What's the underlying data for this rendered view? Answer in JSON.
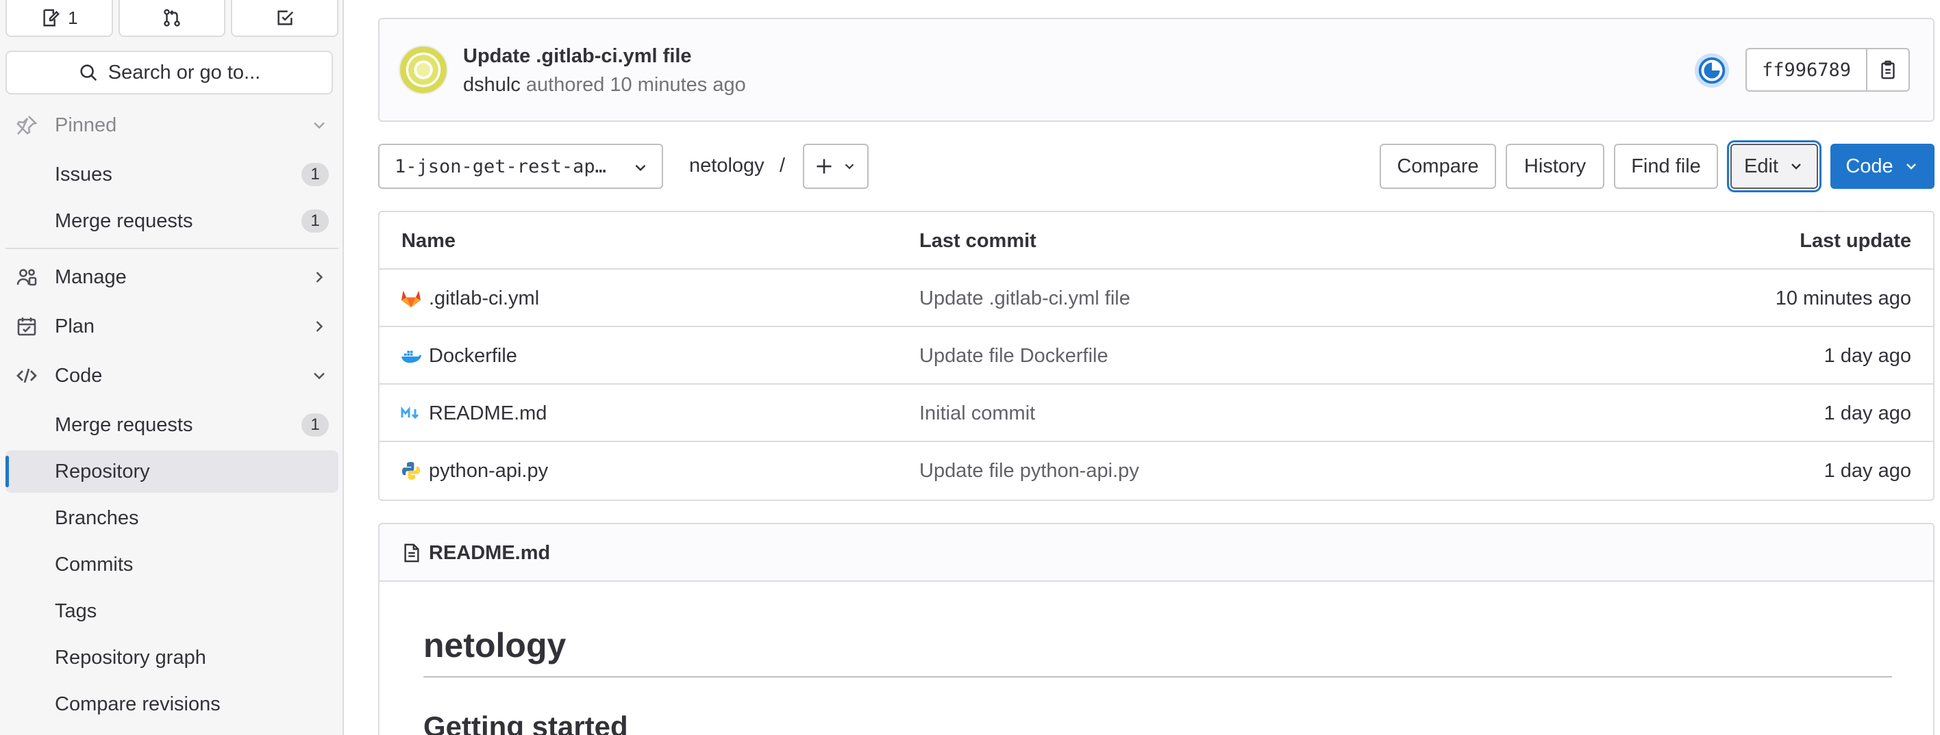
{
  "sidebar": {
    "counters": [
      {
        "icon": "issues-icon",
        "count": "1"
      },
      {
        "icon": "merge-request-icon",
        "count": ""
      },
      {
        "icon": "todo-icon",
        "count": ""
      }
    ],
    "search_label": "Search or go to...",
    "pinned": {
      "label": "Pinned",
      "items": [
        {
          "label": "Issues",
          "badge": "1"
        },
        {
          "label": "Merge requests",
          "badge": "1"
        }
      ]
    },
    "sections": [
      {
        "label": "Manage",
        "icon": "users-icon",
        "state": "collapsed"
      },
      {
        "label": "Plan",
        "icon": "calendar-icon",
        "state": "collapsed"
      },
      {
        "label": "Code",
        "icon": "code-icon",
        "state": "expanded"
      }
    ],
    "code_items": [
      {
        "label": "Merge requests",
        "badge": "1"
      },
      {
        "label": "Repository",
        "active": true
      },
      {
        "label": "Branches"
      },
      {
        "label": "Commits"
      },
      {
        "label": "Tags"
      },
      {
        "label": "Repository graph"
      },
      {
        "label": "Compare revisions"
      }
    ]
  },
  "commit": {
    "title": "Update .gitlab-ci.yml file",
    "author": "dshulc",
    "meta": "authored 10 minutes ago",
    "sha": "ff996789"
  },
  "toolbar": {
    "branch": "1-json-get-rest-ap…",
    "project": "netology",
    "separator": "/",
    "compare": "Compare",
    "history": "History",
    "find_file": "Find file",
    "edit": "Edit",
    "code": "Code"
  },
  "table": {
    "headers": {
      "name": "Name",
      "last_commit": "Last commit",
      "last_update": "Last update"
    },
    "rows": [
      {
        "name": ".gitlab-ci.yml",
        "icon": "gitlab-icon",
        "commit": "Update .gitlab-ci.yml file",
        "updated": "10 minutes ago"
      },
      {
        "name": "Dockerfile",
        "icon": "docker-icon",
        "commit": "Update file Dockerfile",
        "updated": "1 day ago"
      },
      {
        "name": "README.md",
        "icon": "markdown-icon",
        "commit": "Initial commit",
        "updated": "1 day ago"
      },
      {
        "name": "python-api.py",
        "icon": "python-icon",
        "commit": "Update file python-api.py",
        "updated": "1 day ago"
      }
    ]
  },
  "readme": {
    "filename": "README.md",
    "h1": "netology",
    "h2": "Getting started"
  },
  "colors": {
    "accent": "#1f75cb",
    "sidebar_bg": "#f6f6f7",
    "border": "#dcdcde"
  }
}
